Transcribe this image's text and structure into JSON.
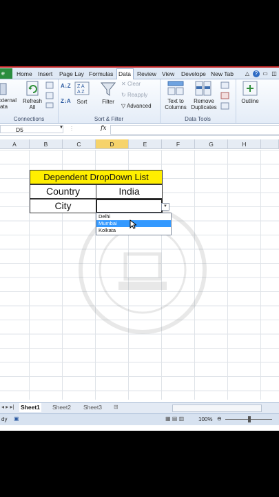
{
  "ribbon_tabs": [
    "e",
    "Home",
    "Insert",
    "Page Lay",
    "Formulas",
    "Data",
    "Review",
    "View",
    "Develope",
    "New Tab"
  ],
  "active_tab": "Data",
  "groups": {
    "connections": {
      "label": "Connections",
      "external_label": "xternal\nata",
      "refresh_label": "Refresh\nAll"
    },
    "sort_filter": {
      "label": "Sort & Filter",
      "sort_label": "Sort",
      "filter_label": "Filter",
      "clear_label": "Clear",
      "reapply_label": "Reapply",
      "advanced_label": "Advanced"
    },
    "data_tools": {
      "label": "Data Tools",
      "text_to_columns_label": "Text to\nColumns",
      "remove_duplicates_label": "Remove\nDuplicates"
    },
    "outline": {
      "label": "Outline"
    }
  },
  "formula_bar": {
    "name_box": "D5",
    "fx": "fx",
    "value": ""
  },
  "columns": [
    "A",
    "B",
    "C",
    "D",
    "E",
    "F",
    "G",
    "H"
  ],
  "selected_column": "D",
  "table": {
    "title": "Dependent DropDown List",
    "country_label": "Country",
    "country_value": "India",
    "city_label": "City",
    "city_value": ""
  },
  "dropdown": {
    "options": [
      "Delhi",
      "Mumbai",
      "Kolkata"
    ],
    "highlighted": "Mumbai"
  },
  "sheets": [
    "Sheet1",
    "Sheet2",
    "Sheet3"
  ],
  "active_sheet": "Sheet1",
  "status": {
    "zoom": "100%"
  },
  "colors": {
    "title_bg": "#ffee00",
    "highlight": "#3399ff",
    "file_tab": "#2a8d3e",
    "selected_col": "#f6d36a"
  }
}
